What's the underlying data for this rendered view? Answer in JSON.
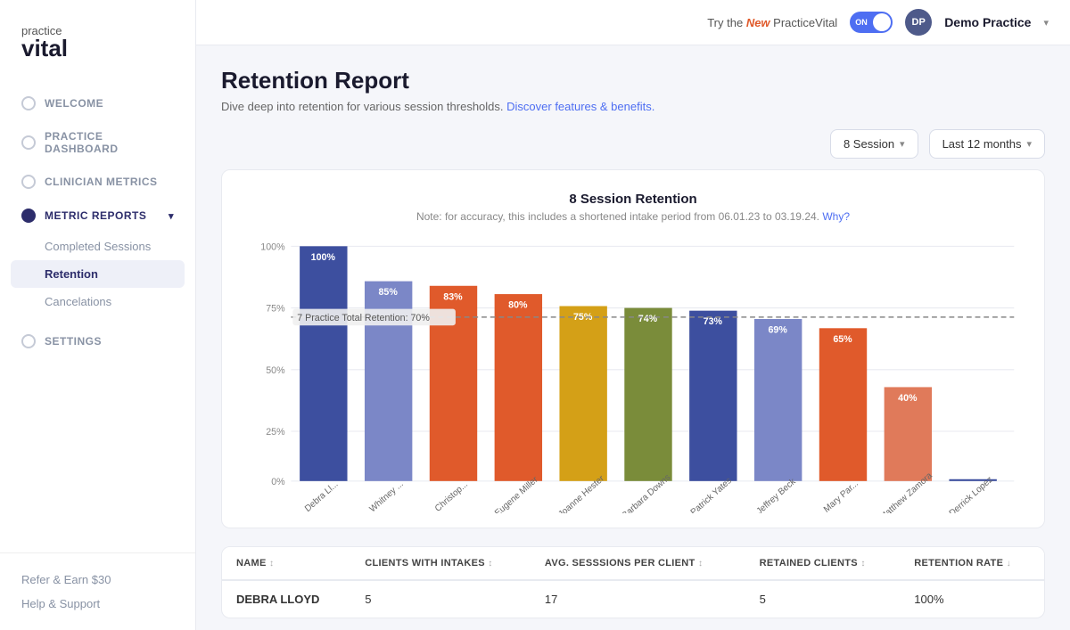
{
  "app": {
    "logo_line1": "practice",
    "logo_line2": "vital"
  },
  "topbar": {
    "new_pill": "Try the",
    "new_word": "New",
    "app_name": "PracticeVital",
    "toggle_label": "ON",
    "user_initials": "DP",
    "practice_name": "Demo Practice"
  },
  "sidebar": {
    "nav_items": [
      {
        "id": "welcome",
        "label": "WELCOME",
        "active": false
      },
      {
        "id": "practice-dashboard",
        "label": "PRACTICE DASHBOARD",
        "active": false
      },
      {
        "id": "clinician-metrics",
        "label": "CLINICIAN METRICS",
        "active": false
      },
      {
        "id": "metric-reports",
        "label": "METRIC REPORTS",
        "active": true,
        "has_chevron": true
      }
    ],
    "sub_items": [
      {
        "id": "completed-sessions",
        "label": "Completed Sessions",
        "active": false
      },
      {
        "id": "retention",
        "label": "Retention",
        "active": true
      },
      {
        "id": "cancelations",
        "label": "Cancelations",
        "active": false
      }
    ],
    "bottom_links": [
      {
        "id": "refer",
        "label": "Refer & Earn $30"
      },
      {
        "id": "help",
        "label": "Help & Support"
      }
    ],
    "settings": {
      "label": "SETTINGS",
      "id": "settings"
    }
  },
  "page": {
    "title": "Retention Report",
    "subtitle": "Dive deep into retention for various session thresholds.",
    "subtitle_link": "Discover features & benefits."
  },
  "filters": {
    "session_filter": "8 Session",
    "time_filter": "Last 12 months"
  },
  "chart": {
    "title": "8 Session Retention",
    "subtitle": "Note: for accuracy, this includes a shortened intake period from 06.01.23 to 03.19.24.",
    "subtitle_link": "Why?",
    "retention_line_label": "7 Practice Total Retention: 70%",
    "retention_line_pct": 70,
    "bars": [
      {
        "name": "Debra Ll...",
        "pct": 100,
        "color": "#3d4f9f"
      },
      {
        "name": "Whitney ...",
        "pct": 85,
        "color": "#7b87c7"
      },
      {
        "name": "Christop... Jones",
        "pct": 83,
        "color": "#e05a2b"
      },
      {
        "name": "Eugene Miller",
        "pct": 80,
        "color": "#e05a2b"
      },
      {
        "name": "Joanne Hester",
        "pct": 75,
        "color": "#d4a017"
      },
      {
        "name": "Barbara Downs",
        "pct": 74,
        "color": "#7a8c3a"
      },
      {
        "name": "Patrick Yates",
        "pct": 73,
        "color": "#3d4f9f"
      },
      {
        "name": "Jeffrey Beck",
        "pct": 69,
        "color": "#7b87c7"
      },
      {
        "name": "Mary Par...",
        "pct": 65,
        "color": "#e05a2b"
      },
      {
        "name": "Matthew Zamora",
        "pct": 40,
        "color": "#e07a5a"
      },
      {
        "name": "Derrick Lopez",
        "pct": 0,
        "color": "#3d4f9f"
      }
    ],
    "y_labels": [
      "100%",
      "75%",
      "50%",
      "25%",
      "0%"
    ]
  },
  "table": {
    "columns": [
      {
        "label": "NAME",
        "sort": "↕"
      },
      {
        "label": "CLIENTS WITH INTAKES",
        "sort": "↕"
      },
      {
        "label": "AVG. SESSSIONS PER CLIENT",
        "sort": "↕"
      },
      {
        "label": "RETAINED CLIENTS",
        "sort": "↕"
      },
      {
        "label": "RETENTION RATE",
        "sort": "↓"
      }
    ],
    "rows": [
      {
        "name": "DEBRA LLOYD",
        "clients_intakes": "5",
        "avg_sessions": "17",
        "retained": "5",
        "rate": "100%"
      }
    ]
  }
}
